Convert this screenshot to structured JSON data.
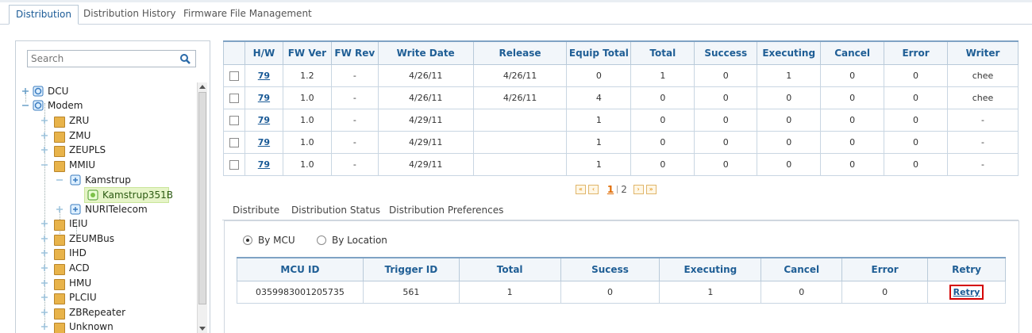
{
  "tabs": [
    "Distribution",
    "Distribution History",
    "Firmware File Management"
  ],
  "search": {
    "placeholder": "Search"
  },
  "tree": {
    "items": [
      "DCU",
      "Modem",
      "ZRU",
      "ZMU",
      "ZEUPLS",
      "MMIU",
      "Kamstrup",
      "Kamstrup351B",
      "NURITelecom",
      "IEIU",
      "ZEUMBus",
      "IHD",
      "ACD",
      "HMU",
      "PLCIU",
      "ZBRepeater",
      "Unknown"
    ],
    "selected": "Kamstrup351B"
  },
  "distribution_table": {
    "headers": [
      "H/W",
      "FW Ver",
      "FW Rev",
      "Write Date",
      "Release",
      "Equip Total",
      "Total",
      "Success",
      "Executing",
      "Cancel",
      "Error",
      "Writer"
    ],
    "rows": [
      [
        "79",
        "1.2",
        "-",
        "4/26/11",
        "4/26/11",
        "0",
        "1",
        "0",
        "1",
        "0",
        "0",
        "chee"
      ],
      [
        "79",
        "1.0",
        "-",
        "4/26/11",
        "4/26/11",
        "4",
        "0",
        "0",
        "0",
        "0",
        "0",
        "chee"
      ],
      [
        "79",
        "1.0",
        "-",
        "4/29/11",
        "",
        "1",
        "0",
        "0",
        "0",
        "0",
        "0",
        "-"
      ],
      [
        "79",
        "1.0",
        "-",
        "4/29/11",
        "",
        "1",
        "0",
        "0",
        "0",
        "0",
        "0",
        "-"
      ],
      [
        "79",
        "1.0",
        "-",
        "4/29/11",
        "",
        "1",
        "0",
        "0",
        "0",
        "0",
        "0",
        "-"
      ]
    ]
  },
  "pager": {
    "pages": [
      "1",
      "2"
    ],
    "current": "1"
  },
  "subtabs": [
    "Distribute",
    "Distribution Status",
    "Distribution Preferences"
  ],
  "radio": {
    "options": [
      "By MCU",
      "By Location"
    ],
    "selected": "By MCU"
  },
  "mcu_table": {
    "headers": [
      "MCU ID",
      "Trigger ID",
      "Total",
      "Sucess",
      "Executing",
      "Cancel",
      "Error",
      "Retry"
    ],
    "rows": [
      [
        "0359983001205735",
        "561",
        "1",
        "0",
        "1",
        "0",
        "0",
        "Retry"
      ]
    ]
  },
  "colors": {
    "accent": "#1a5a96",
    "header_border": "#7fa2c4",
    "highlight": "#d40000",
    "selected_node": "#e6f4c8"
  },
  "icons": [
    "search-icon",
    "network-icon",
    "folder-icon",
    "expand-icon",
    "collapse-icon",
    "first-page-icon",
    "prev-page-icon",
    "next-page-icon",
    "last-page-icon"
  ]
}
